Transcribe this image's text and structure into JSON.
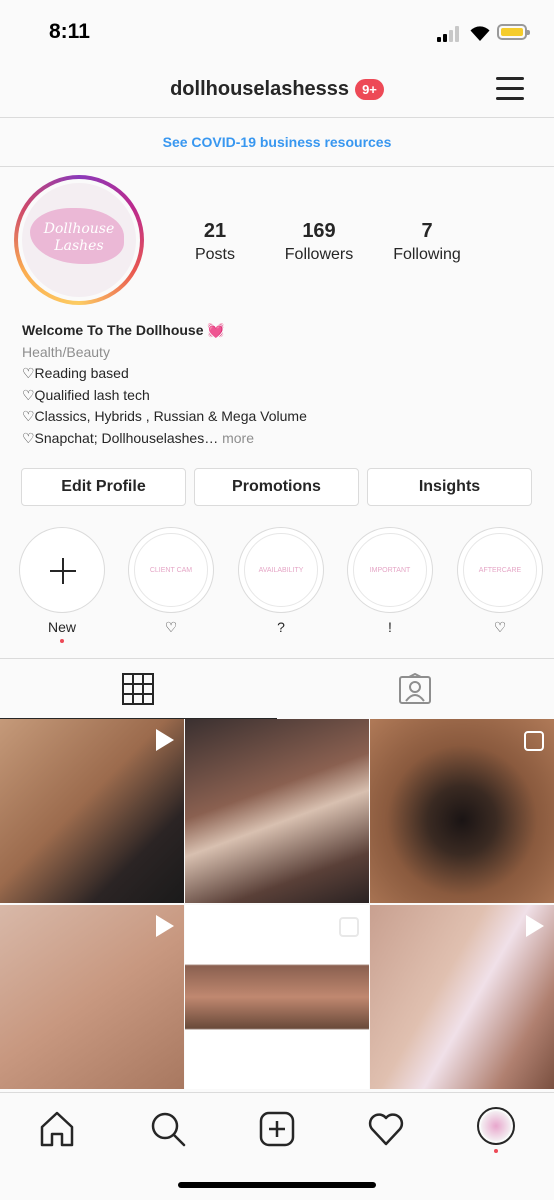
{
  "status_bar": {
    "time": "8:11"
  },
  "header": {
    "username": "dollhouselashesss",
    "notification_count": "9+"
  },
  "covid_banner": "See COVID-19 business resources",
  "profile": {
    "avatar_text": "Dollhouse Lashes",
    "stats": [
      {
        "value": "21",
        "label": "Posts"
      },
      {
        "value": "169",
        "label": "Followers"
      },
      {
        "value": "7",
        "label": "Following"
      }
    ],
    "bio": {
      "name": "Welcome To The Dollhouse 💓",
      "category": "Health/Beauty",
      "lines": [
        "♡Reading based",
        "♡Qualified lash tech",
        "♡Classics, Hybrids , Russian & Mega Volume",
        "♡Snapchat; Dollhouselashes…"
      ],
      "more": "more"
    }
  },
  "buttons": {
    "edit_profile": "Edit Profile",
    "promotions": "Promotions",
    "insights": "Insights"
  },
  "highlights": [
    {
      "label": "New",
      "cover": ""
    },
    {
      "label": "♡",
      "cover": "CLIENT CAM"
    },
    {
      "label": "?",
      "cover": "AVAILABILITY"
    },
    {
      "label": "!",
      "cover": "IMPORTANT"
    },
    {
      "label": "♡",
      "cover": "AFTERCARE"
    }
  ],
  "icons": {
    "grid_tab": "grid-icon",
    "tagged_tab": "tagged-person-icon",
    "home": "home-icon",
    "search": "search-icon",
    "add": "add-post-icon",
    "activity": "heart-icon",
    "profile": "profile-avatar-icon"
  },
  "colors": {
    "accent_blue": "#3897f0",
    "badge_red": "#ed4956",
    "brand_pink": "#e8a6cc"
  }
}
